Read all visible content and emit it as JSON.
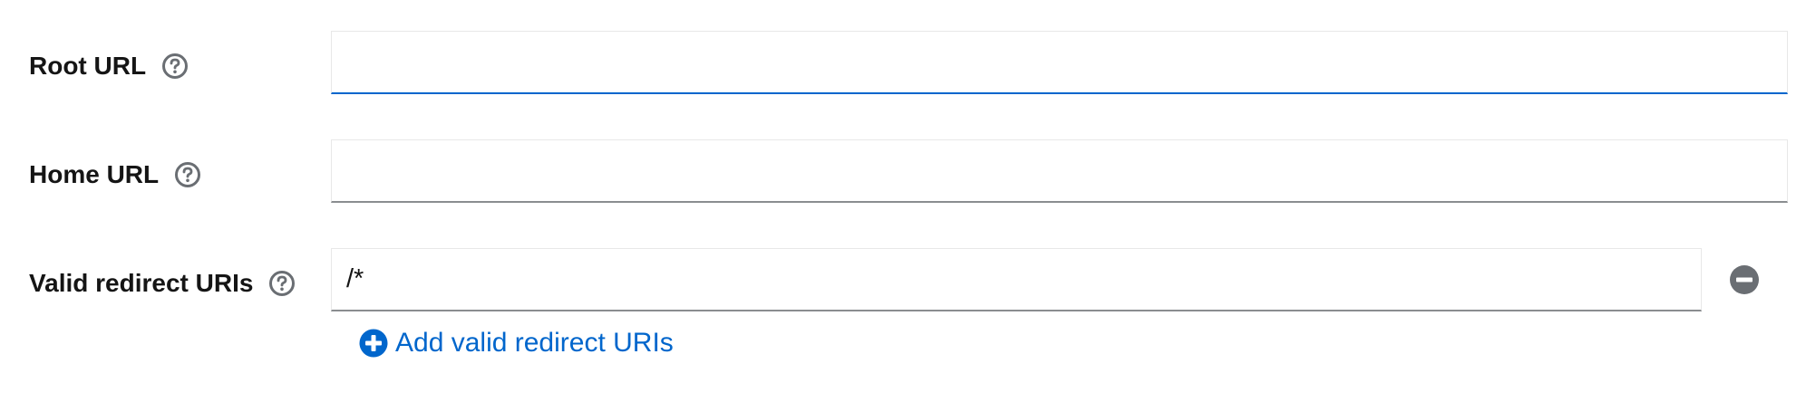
{
  "fields": {
    "root_url": {
      "label": "Root URL",
      "value": "",
      "help_icon": "question-circle-icon"
    },
    "home_url": {
      "label": "Home URL",
      "value": "",
      "help_icon": "question-circle-icon"
    },
    "valid_redirect_uris": {
      "label": "Valid redirect URIs",
      "values": [
        "/*"
      ],
      "help_icon": "question-circle-icon",
      "remove_icon": "minus-circle-icon",
      "add_label": "Add valid redirect URIs",
      "add_icon": "plus-circle-icon"
    }
  },
  "colors": {
    "label_text": "#151515",
    "link": "#0066cc",
    "focus_border": "#0066cc",
    "input_border": "#8a8d90",
    "icon_gray": "#6a6e73"
  }
}
